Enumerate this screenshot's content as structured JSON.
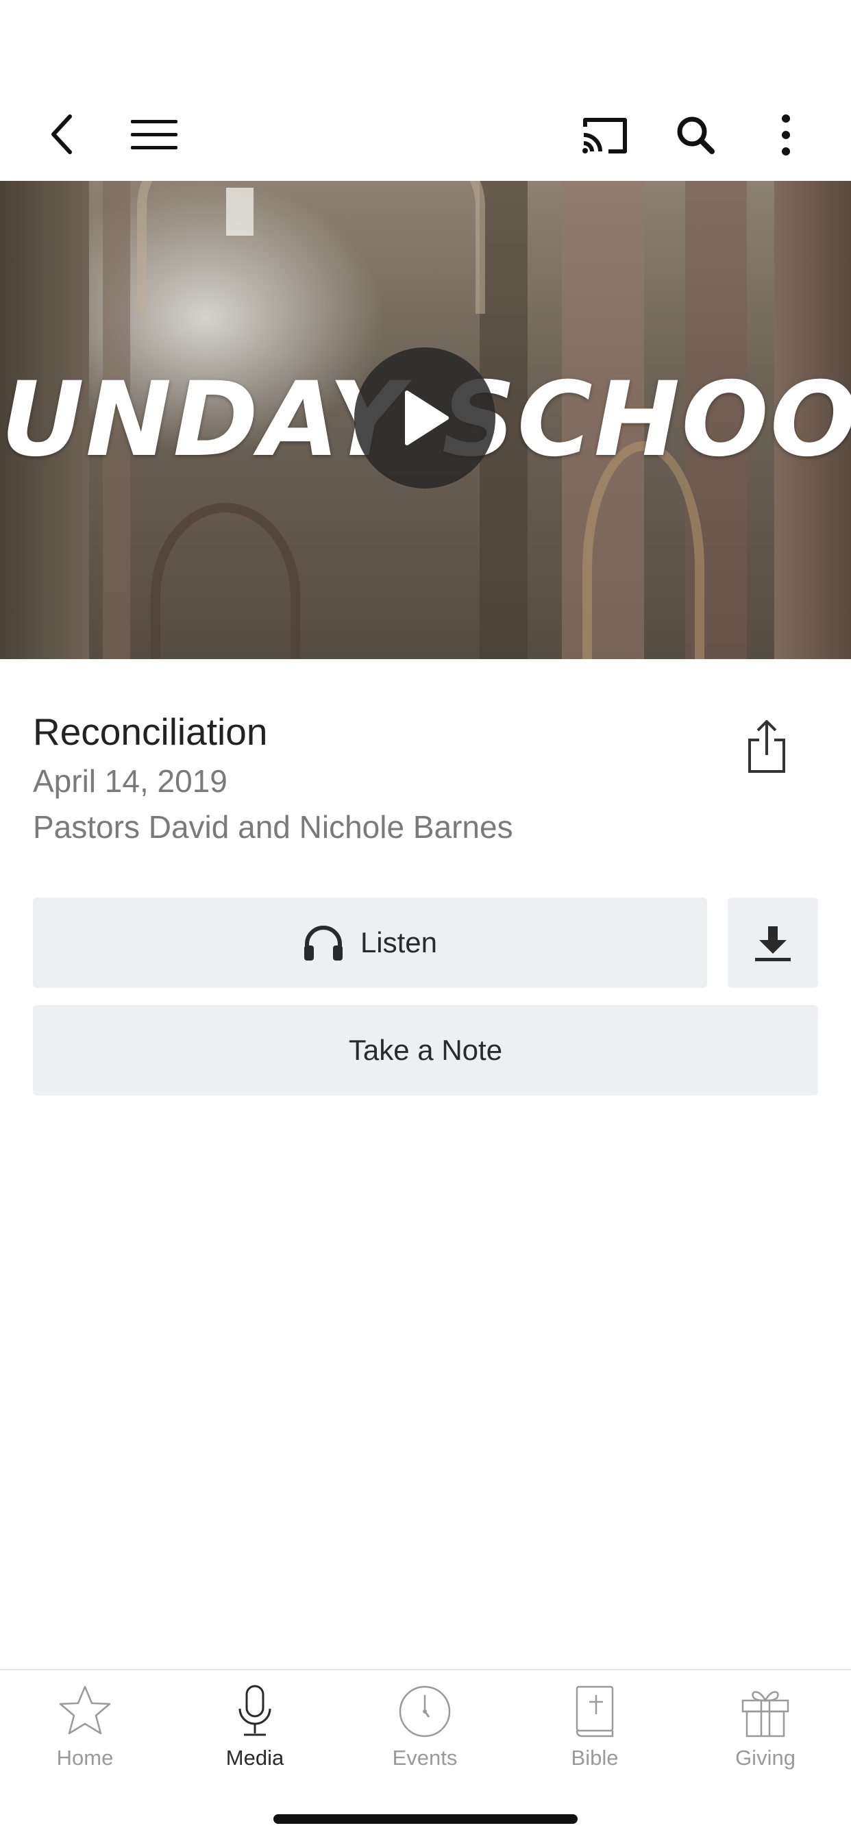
{
  "toolbar": {
    "back_icon": "chevron-left-icon",
    "menu_icon": "hamburger-menu-icon",
    "cast_icon": "cast-icon",
    "search_icon": "search-icon",
    "more_icon": "more-vertical-icon"
  },
  "hero": {
    "title": "SUNDAY SCHOOL",
    "play_icon": "play-icon"
  },
  "media": {
    "title": "Reconciliation",
    "date": "April 14, 2019",
    "speaker": "Pastors David and Nichole Barnes",
    "share_icon": "share-icon"
  },
  "actions": {
    "listen_label": "Listen",
    "listen_icon": "headphones-icon",
    "download_icon": "download-icon",
    "note_label": "Take a Note"
  },
  "tabs": [
    {
      "label": "Home",
      "icon": "star-icon",
      "active": false
    },
    {
      "label": "Media",
      "icon": "microphone-icon",
      "active": true
    },
    {
      "label": "Events",
      "icon": "clock-icon",
      "active": false
    },
    {
      "label": "Bible",
      "icon": "bible-icon",
      "active": false
    },
    {
      "label": "Giving",
      "icon": "gift-icon",
      "active": false
    }
  ],
  "colors": {
    "button_bg": "#eeeff0",
    "text_primary": "#222222",
    "text_secondary": "#7a7a7a",
    "tab_inactive": "#9a9a9a"
  }
}
